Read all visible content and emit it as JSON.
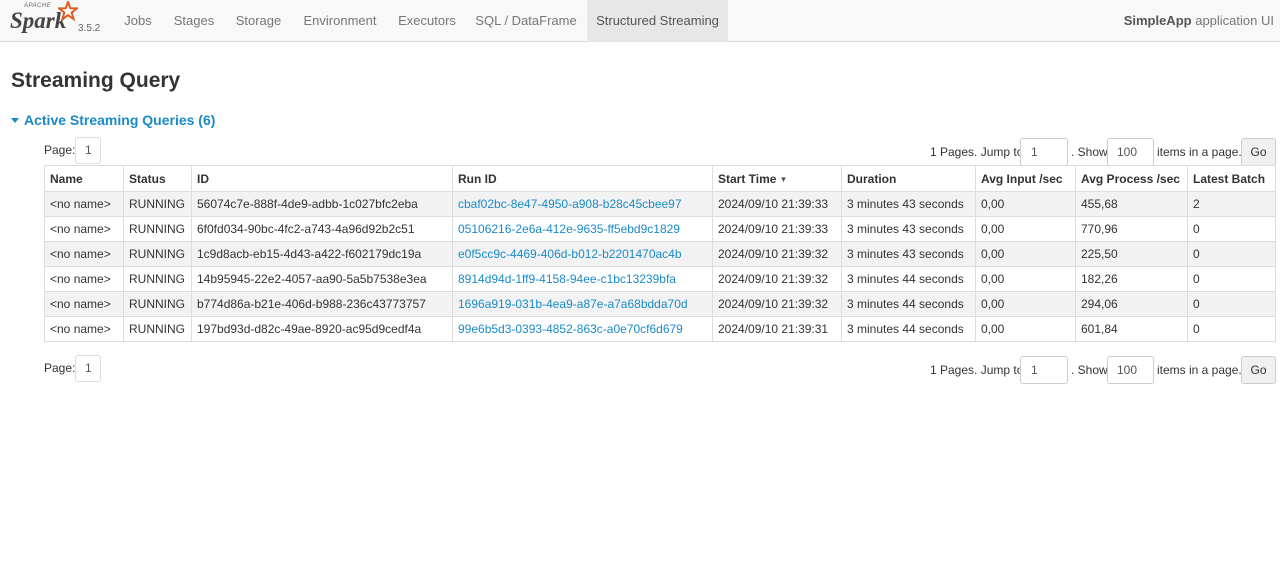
{
  "navbar": {
    "brand_small": "APACHE",
    "brand_word": "Spark",
    "version": "3.5.2",
    "tabs": [
      {
        "label": "Jobs",
        "active": false
      },
      {
        "label": "Stages",
        "active": false
      },
      {
        "label": "Storage",
        "active": false
      },
      {
        "label": "Environment",
        "active": false
      },
      {
        "label": "Executors",
        "active": false
      },
      {
        "label": "SQL / DataFrame",
        "active": false
      },
      {
        "label": "Structured Streaming",
        "active": true
      }
    ],
    "app_name": "SimpleApp",
    "app_suffix": "application UI"
  },
  "page_title": "Streaming Query",
  "section_title": "Active Streaming Queries (6)",
  "pagination": {
    "page_label": "Page:",
    "page_value": "1",
    "pages_text": "1 Pages. Jump to",
    "jump_value": "1",
    "show_text": ". Show",
    "size_value": "100",
    "items_text": "items in a page.",
    "go_label": "Go"
  },
  "table": {
    "headers": [
      "Name",
      "Status",
      "ID",
      "Run ID",
      "Start Time",
      "Duration",
      "Avg Input /sec",
      "Avg Process /sec",
      "Latest Batch"
    ],
    "sort_indicator": "▼",
    "rows": [
      {
        "name": "<no name>",
        "status": "RUNNING",
        "id": "56074c7e-888f-4de9-adbb-1c027bfc2eba",
        "run_id": "cbaf02bc-8e47-4950-a908-b28c45cbee97",
        "start": "2024/09/10 21:39:33",
        "duration": "3 minutes 43 seconds",
        "input": "0,00",
        "process": "455,68",
        "batch": "2"
      },
      {
        "name": "<no name>",
        "status": "RUNNING",
        "id": "6f0fd034-90bc-4fc2-a743-4a96d92b2c51",
        "run_id": "05106216-2e6a-412e-9635-ff5ebd9c1829",
        "start": "2024/09/10 21:39:33",
        "duration": "3 minutes 43 seconds",
        "input": "0,00",
        "process": "770,96",
        "batch": "0"
      },
      {
        "name": "<no name>",
        "status": "RUNNING",
        "id": "1c9d8acb-eb15-4d43-a422-f602179dc19a",
        "run_id": "e0f5cc9c-4469-406d-b012-b2201470ac4b",
        "start": "2024/09/10 21:39:32",
        "duration": "3 minutes 43 seconds",
        "input": "0,00",
        "process": "225,50",
        "batch": "0"
      },
      {
        "name": "<no name>",
        "status": "RUNNING",
        "id": "14b95945-22e2-4057-aa90-5a5b7538e3ea",
        "run_id": "8914d94d-1ff9-4158-94ee-c1bc13239bfa",
        "start": "2024/09/10 21:39:32",
        "duration": "3 minutes 44 seconds",
        "input": "0,00",
        "process": "182,26",
        "batch": "0"
      },
      {
        "name": "<no name>",
        "status": "RUNNING",
        "id": "b774d86a-b21e-406d-b988-236c43773757",
        "run_id": "1696a919-031b-4ea9-a87e-a7a68bdda70d",
        "start": "2024/09/10 21:39:32",
        "duration": "3 minutes 44 seconds",
        "input": "0,00",
        "process": "294,06",
        "batch": "0"
      },
      {
        "name": "<no name>",
        "status": "RUNNING",
        "id": "197bd93d-d82c-49ae-8920-ac95d9cedf4a",
        "run_id": "99e6b5d3-0393-4852-863c-a0e70cf6d679",
        "start": "2024/09/10 21:39:31",
        "duration": "3 minutes 44 seconds",
        "input": "0,00",
        "process": "601,84",
        "batch": "0"
      }
    ]
  },
  "colors": {
    "link": "#1a8ac7",
    "nav_active_bg": "#e7e7e7",
    "spark_star": "#e25a1c"
  }
}
